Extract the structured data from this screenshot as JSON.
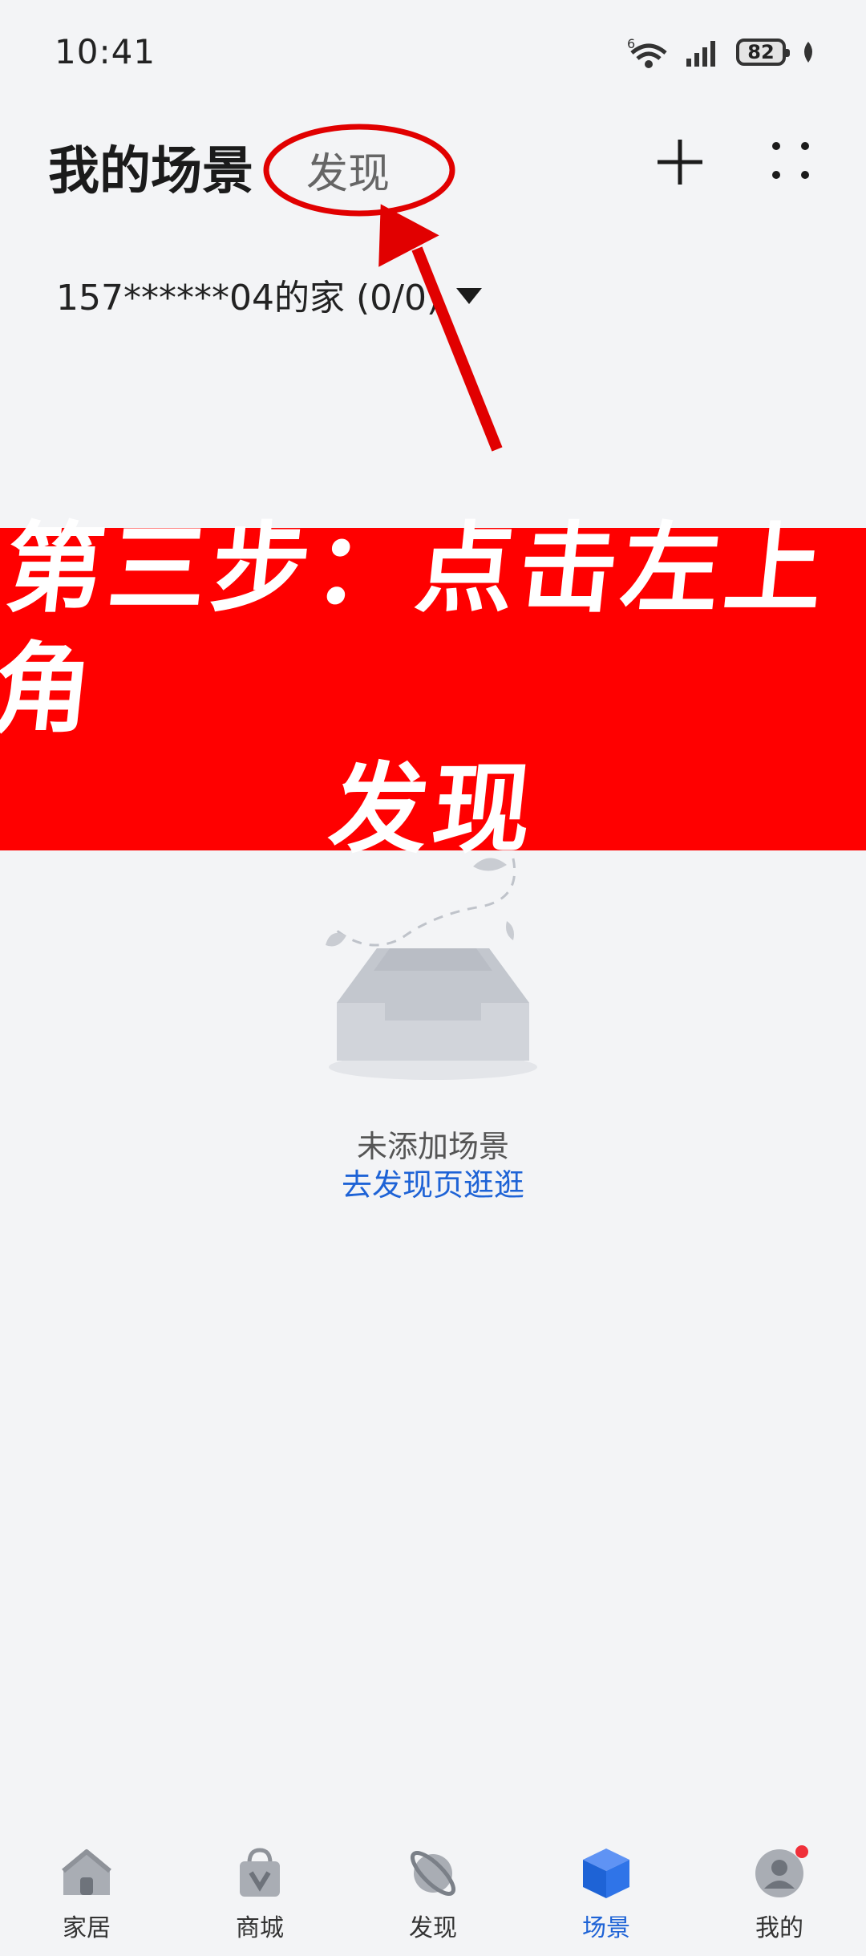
{
  "status": {
    "time": "10:41",
    "network_label": "6",
    "battery": "82"
  },
  "header": {
    "title": "我的场景",
    "discover_tab": "发现",
    "home_selector": "157******04的家 (0/0)"
  },
  "banner": {
    "line1": "第三步：点击左上角",
    "line2": "发现"
  },
  "empty_state": {
    "text": "未添加场景",
    "link": "去发现页逛逛"
  },
  "bottom_nav": {
    "items": [
      {
        "label": "家居",
        "icon": "home-icon"
      },
      {
        "label": "商城",
        "icon": "shopping-bag-icon"
      },
      {
        "label": "发现",
        "icon": "planet-icon"
      },
      {
        "label": "场景",
        "icon": "cube-icon",
        "active": true
      },
      {
        "label": "我的",
        "icon": "profile-icon"
      }
    ]
  },
  "colors": {
    "accent": "#1e63d6",
    "banner": "#ff0000",
    "annotation": "#e10000",
    "background": "#f3f4f6"
  }
}
